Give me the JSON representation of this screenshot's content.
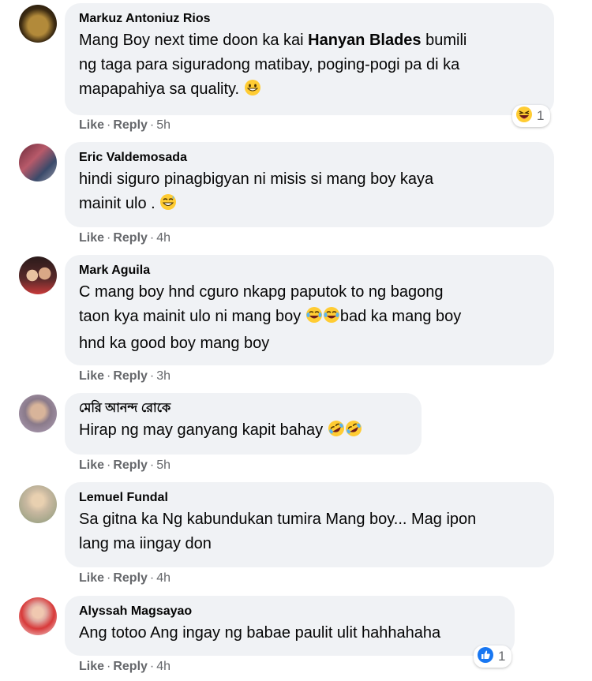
{
  "actions": {
    "like": "Like",
    "reply": "Reply",
    "separator": "·"
  },
  "comments": [
    {
      "author": "Markuz Antoniuz Rios",
      "text_line1_prefix": "Mang Boy next time doon ka kai ",
      "text_line1_bold": "Hanyan Blades",
      "text_line1_suffix": " bumili",
      "text_line2": "ng taga para siguradong matibay, poging-pogi pa di ka",
      "text_line3": "mapapahiya sa quality.",
      "time": "5h",
      "reaction_count": "1"
    },
    {
      "author": "Eric Valdemosada",
      "text_line1": "hindi siguro pinagbigyan ni misis si mang boy kaya",
      "text_line2": "mainit ulo .",
      "time": "4h"
    },
    {
      "author": "Mark Aguila",
      "text_line1": "C mang boy hnd cguro nkapg paputok to ng bagong",
      "text_line2_prefix": "taon kya mainit ulo ni mang boy ",
      "text_line2_suffix": "bad ka mang boy",
      "text_line3": "hnd ka good boy mang boy",
      "time": "3h"
    },
    {
      "author": "মেরি আনন্দ রোকে",
      "text_line1": "Hirap ng may ganyang kapit bahay ",
      "time": "5h"
    },
    {
      "author": "Lemuel Fundal",
      "text_line1": "Sa gitna ka Ng kabundukan tumira Mang boy... Mag ipon",
      "text_line2": "lang ma iingay don",
      "time": "4h"
    },
    {
      "author": "Alyssah Magsayao",
      "text_line1": "Ang totoo Ang ingay ng babae paulit ulit hahhahaha",
      "time": "4h",
      "reaction_count": "1"
    }
  ],
  "colors": {
    "bubble": "#f0f2f5",
    "meta": "#65676b",
    "like_blue": "#1877f2"
  }
}
